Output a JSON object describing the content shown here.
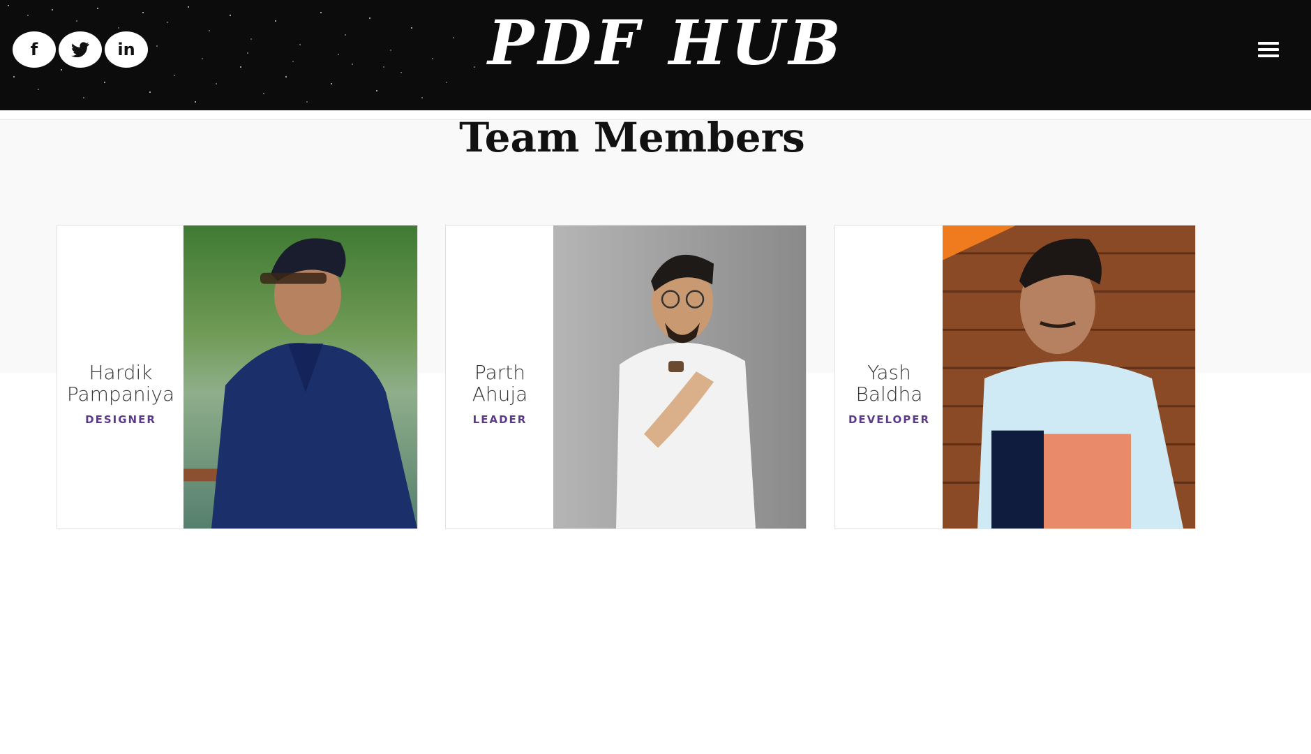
{
  "header": {
    "brand": "PDF HUB",
    "social": [
      {
        "icon": "facebook-icon",
        "glyph": "f"
      },
      {
        "icon": "twitter-icon",
        "glyph": "🐦"
      },
      {
        "icon": "linkedin-icon",
        "glyph": "in"
      }
    ],
    "menu_icon": "hamburger-menu-icon"
  },
  "section": {
    "title": "Team Members"
  },
  "members": [
    {
      "name_first": "Hardik",
      "name_last": "Pampaniya",
      "role": "DESIGNER"
    },
    {
      "name_first": "Parth",
      "name_last": "Ahuja",
      "role": "LEADER"
    },
    {
      "name_first": "Yash",
      "name_last": "Baldha",
      "role": "DEVELOPER"
    }
  ],
  "colors": {
    "header_bg": "#0c0c0c",
    "accent_role": "#5b3a8a",
    "section_bg": "#f9f9f9"
  }
}
